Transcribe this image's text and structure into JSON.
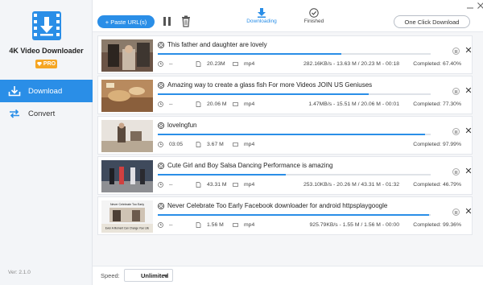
{
  "app": {
    "name": "4K Video Downloader",
    "badge": "PRO",
    "version": "Ver: 2.1.0",
    "accent": "#2a8ee7",
    "badge_color": "#f5a623"
  },
  "sidebar": {
    "items": [
      {
        "label": "Download",
        "icon": "download-icon",
        "active": true
      },
      {
        "label": "Convert",
        "icon": "convert-icon",
        "active": false
      }
    ]
  },
  "toolbar": {
    "paste_label": "+ Paste URL(s)",
    "pause_icon": "pause-icon",
    "delete_icon": "trash-icon",
    "tabs": [
      {
        "label": "Downloading",
        "icon": "download-arrow-icon",
        "active": true
      },
      {
        "label": "Finished",
        "icon": "check-circle-icon",
        "active": false
      }
    ],
    "one_click_label": "One Click Download"
  },
  "downloads": [
    {
      "title": "This father and daughter are lovely",
      "time": "--",
      "size": "20.23M",
      "format": "mp4",
      "speed_info": "282.16KB/s - 13.63 M / 20.23 M - 00:18",
      "completed": "Completed: 67.40%",
      "progress": 0.674
    },
    {
      "title": "Amazing way to create a glass fish  For more Videos JOIN US  Geniuses",
      "time": "--",
      "size": "20.06 M",
      "format": "mp4",
      "speed_info": "1.47MB/s - 15.51 M / 20.06 M - 00:01",
      "completed": "Completed: 77.30%",
      "progress": 0.773
    },
    {
      "title": "lovelngfun",
      "time": "03:05",
      "size": "3.67 M",
      "format": "mp4",
      "speed_info": "",
      "completed": "Completed: 97.99%",
      "progress": 0.9799
    },
    {
      "title": "Cute Girl and Boy Salsa Dancing Performance is amazing",
      "time": "--",
      "size": "43.31 M",
      "format": "mp4",
      "speed_info": "253.10KB/s - 20.26 M / 43.31 M - 01:32",
      "completed": "Completed: 46.79%",
      "progress": 0.4679
    },
    {
      "title": "Never Celebrate Too Early Facebook downloader for android httpsplaygoogle",
      "time": "--",
      "size": "1.56 M",
      "format": "mp4",
      "speed_info": "925.79KB/s - 1.55 M / 1.56 M - 00:00",
      "completed": "Completed: 99.36%",
      "progress": 0.9936
    }
  ],
  "thumb_texts": {
    "t5_top": "Never Celebrate Too Early",
    "t5_bottom": "Even A Moment Can Change Your Life"
  },
  "statusbar": {
    "speed_label": "Speed:",
    "speed_value": "Unlimited"
  }
}
